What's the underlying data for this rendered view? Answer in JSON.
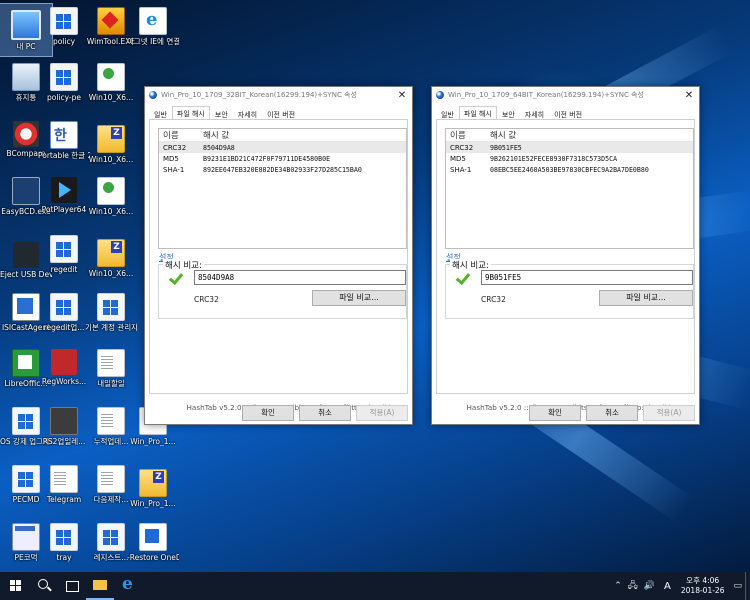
{
  "desktop": {
    "icons": [
      {
        "label": "내 PC",
        "icon": "pc-icon"
      },
      {
        "label": "policy",
        "icon": "app-icon"
      },
      {
        "label": "WimTool.EXE",
        "icon": "wimtool-icon"
      },
      {
        "label": "마그넷 IE에 연결하기",
        "icon": "ie-icon"
      },
      {
        "label": "휴지통",
        "icon": "recycle-bin-icon"
      },
      {
        "label": "policy-pe",
        "icon": "app-icon"
      },
      {
        "label": "Win10_X6...",
        "icon": "torrent-icon"
      },
      {
        "label": "BCompare",
        "icon": "bcompare-icon"
      },
      {
        "label": "Portable 한글 2010",
        "icon": "hwp-icon"
      },
      {
        "label": "Win10_X6...",
        "icon": "zip-folder-icon"
      },
      {
        "label": "EasyBCD.exe",
        "icon": "easybcd-icon"
      },
      {
        "label": "PotPlayer64",
        "icon": "potplayer-icon"
      },
      {
        "label": "Win10_X6...",
        "icon": "torrent-icon"
      },
      {
        "label": "Eject USB Devices",
        "icon": "usb-icon"
      },
      {
        "label": "regedit",
        "icon": "app-icon"
      },
      {
        "label": "Win10_X6...",
        "icon": "zip-folder-icon"
      },
      {
        "label": "ISICastAgent",
        "icon": "isis-icon"
      },
      {
        "label": "regedit업...",
        "icon": "app-icon"
      },
      {
        "label": "기본 계정 관리자 계...",
        "icon": "app-icon"
      },
      {
        "label": "LibreOffic...",
        "icon": "calc-icon"
      },
      {
        "label": "RegWorks...",
        "icon": "regworks-icon"
      },
      {
        "label": "내일할일",
        "icon": "document-icon"
      },
      {
        "label": "OS 강제 업그레이...",
        "icon": "app-icon"
      },
      {
        "label": "RS2업일레...",
        "icon": "cmd-icon"
      },
      {
        "label": "누적업데...",
        "icon": "document-icon"
      },
      {
        "label": "Win_Pro_1...",
        "icon": "torrent-icon"
      },
      {
        "label": "PECMD",
        "icon": "app-icon"
      },
      {
        "label": "Telegram",
        "icon": "document-icon"
      },
      {
        "label": "다음제작...",
        "icon": "document-icon"
      },
      {
        "label": "Win_Pro_1...",
        "icon": "zip-folder-icon"
      },
      {
        "label": "PE코먹",
        "icon": "pe-icon"
      },
      {
        "label": "tray",
        "icon": "app-icon"
      },
      {
        "label": "레지스트...",
        "icon": "app-icon"
      },
      {
        "label": "-Restore OneDrive ...",
        "icon": "restore-icon"
      }
    ]
  },
  "dialogs": [
    {
      "title": "Win_Pro_10_1709_32BIT_Korean(16299.194)+SYNC 속성",
      "tabs": [
        "일반",
        "파일 해시",
        "보안",
        "자세히",
        "이전 버전"
      ],
      "active_tab": "파일 해시",
      "col_name": "이름",
      "col_value": "해시 값",
      "rows": [
        {
          "name": "CRC32",
          "value": "8504D9A8"
        },
        {
          "name": "MD5",
          "value": "B9231E1BD21C472F0F79711DE4580B0E"
        },
        {
          "name": "SHA-1",
          "value": "892EE647EB320E882DE34B02933F27D285C15BA0"
        }
      ],
      "settings_link": "설정",
      "compare_label": "해시 비교:",
      "compare_value": "8504D9A8",
      "compare_algo": "CRC32",
      "compare_button": "파일 비교...",
      "footer": "HashTab v5.2.0 :: ©2010 Implbits Software [http://implbits.co",
      "ok": "확인",
      "cancel": "취소",
      "apply": "적용(A)"
    },
    {
      "title": "Win_Pro_10_1709_64BIT_Korean(16299.194)+SYNC 속성",
      "tabs": [
        "일반",
        "파일 해시",
        "보안",
        "자세히",
        "이전 버전"
      ],
      "active_tab": "파일 해시",
      "col_name": "이름",
      "col_value": "해시 값",
      "rows": [
        {
          "name": "CRC32",
          "value": "9B051FE5"
        },
        {
          "name": "MD5",
          "value": "9B262101E52FECE8930F7318C573D5CA"
        },
        {
          "name": "SHA-1",
          "value": "08EBC5EE2460A503BE97830CBFEC9A2BA7DE0B80"
        }
      ],
      "settings_link": "설정",
      "compare_label": "해시 비교:",
      "compare_value": "9B051FE5",
      "compare_algo": "CRC32",
      "compare_button": "파일 비교...",
      "footer": "HashTab v5.2.0 :: ©2010 Implbits Software [http://implbits.com",
      "ok": "확인",
      "cancel": "취소",
      "apply": "적용(A)"
    }
  ],
  "taskbar": {
    "tray_ime": "A",
    "time": "오후 4:06",
    "date": "2018-01-26"
  },
  "colors": {
    "accent": "#56b12b",
    "link": "#2e6fc6",
    "taskbar": "#101a2a"
  }
}
